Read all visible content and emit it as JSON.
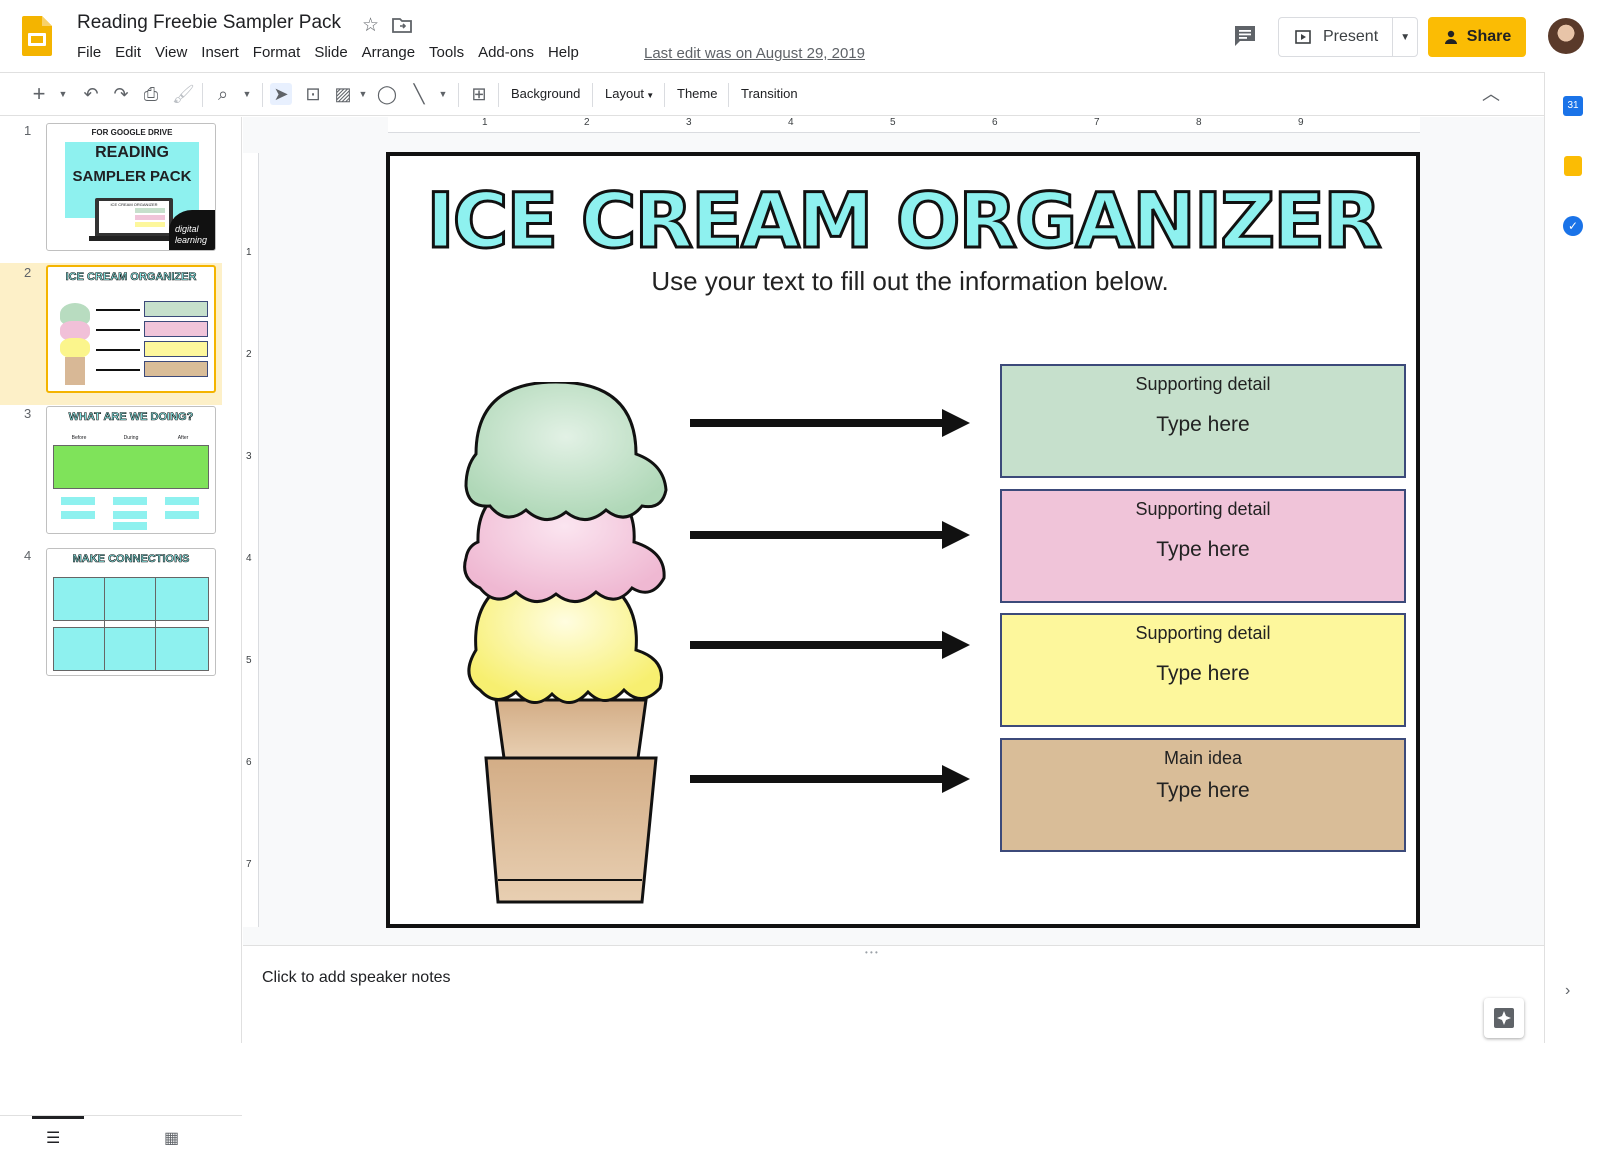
{
  "app": {
    "doc_title": "Reading Freebie Sampler Pack",
    "menu": [
      "File",
      "Edit",
      "View",
      "Insert",
      "Format",
      "Slide",
      "Arrange",
      "Tools",
      "Add-ons",
      "Help"
    ],
    "last_edit": "Last edit was on August 29, 2019",
    "present_label": "Present",
    "share_label": "Share",
    "brand_color": "#fbbc04"
  },
  "toolbar": {
    "background": "Background",
    "layout": "Layout",
    "theme": "Theme",
    "transition": "Transition"
  },
  "filmstrip": {
    "slides": [
      {
        "number": "1",
        "top_label": "FOR GOOGLE DRIVE",
        "title_line1": "READING",
        "title_line2": "SAMPLER PACK",
        "sub": "ICE CREAM ORGANIZER",
        "badge_line1": "digital",
        "badge_line2": "learning"
      },
      {
        "number": "2",
        "title": "ICE CREAM ORGANIZER"
      },
      {
        "number": "3",
        "title": "WHAT ARE WE DOING?",
        "cols": [
          "Before",
          "During",
          "After"
        ]
      },
      {
        "number": "4",
        "title": "MAKE CONNECTIONS"
      }
    ],
    "selected": 2
  },
  "ruler": {
    "h_marks": [
      "1",
      "2",
      "3",
      "4",
      "5",
      "6",
      "7",
      "8",
      "9"
    ],
    "v_marks": [
      "1",
      "2",
      "3",
      "4",
      "5",
      "6",
      "7"
    ]
  },
  "slide": {
    "title": "ICE CREAM ORGANIZER",
    "subtitle": "Use your text to fill out the information below.",
    "boxes": [
      {
        "label": "Supporting detail",
        "body": "Type here",
        "color": "#c6e0cc"
      },
      {
        "label": "Supporting detail",
        "body": "Type here",
        "color": "#f0c4d9"
      },
      {
        "label": "Supporting detail",
        "body": "Type here",
        "color": "#fdf79c"
      },
      {
        "label": "Main idea",
        "body": "Type here",
        "color": "#d9bd98"
      }
    ],
    "scoop_colors": [
      "#b8dcc0",
      "#f1c0d8",
      "#fbf58c"
    ],
    "cone_color": "#d8b896"
  },
  "notes": {
    "placeholder": "Click to add speaker notes"
  }
}
